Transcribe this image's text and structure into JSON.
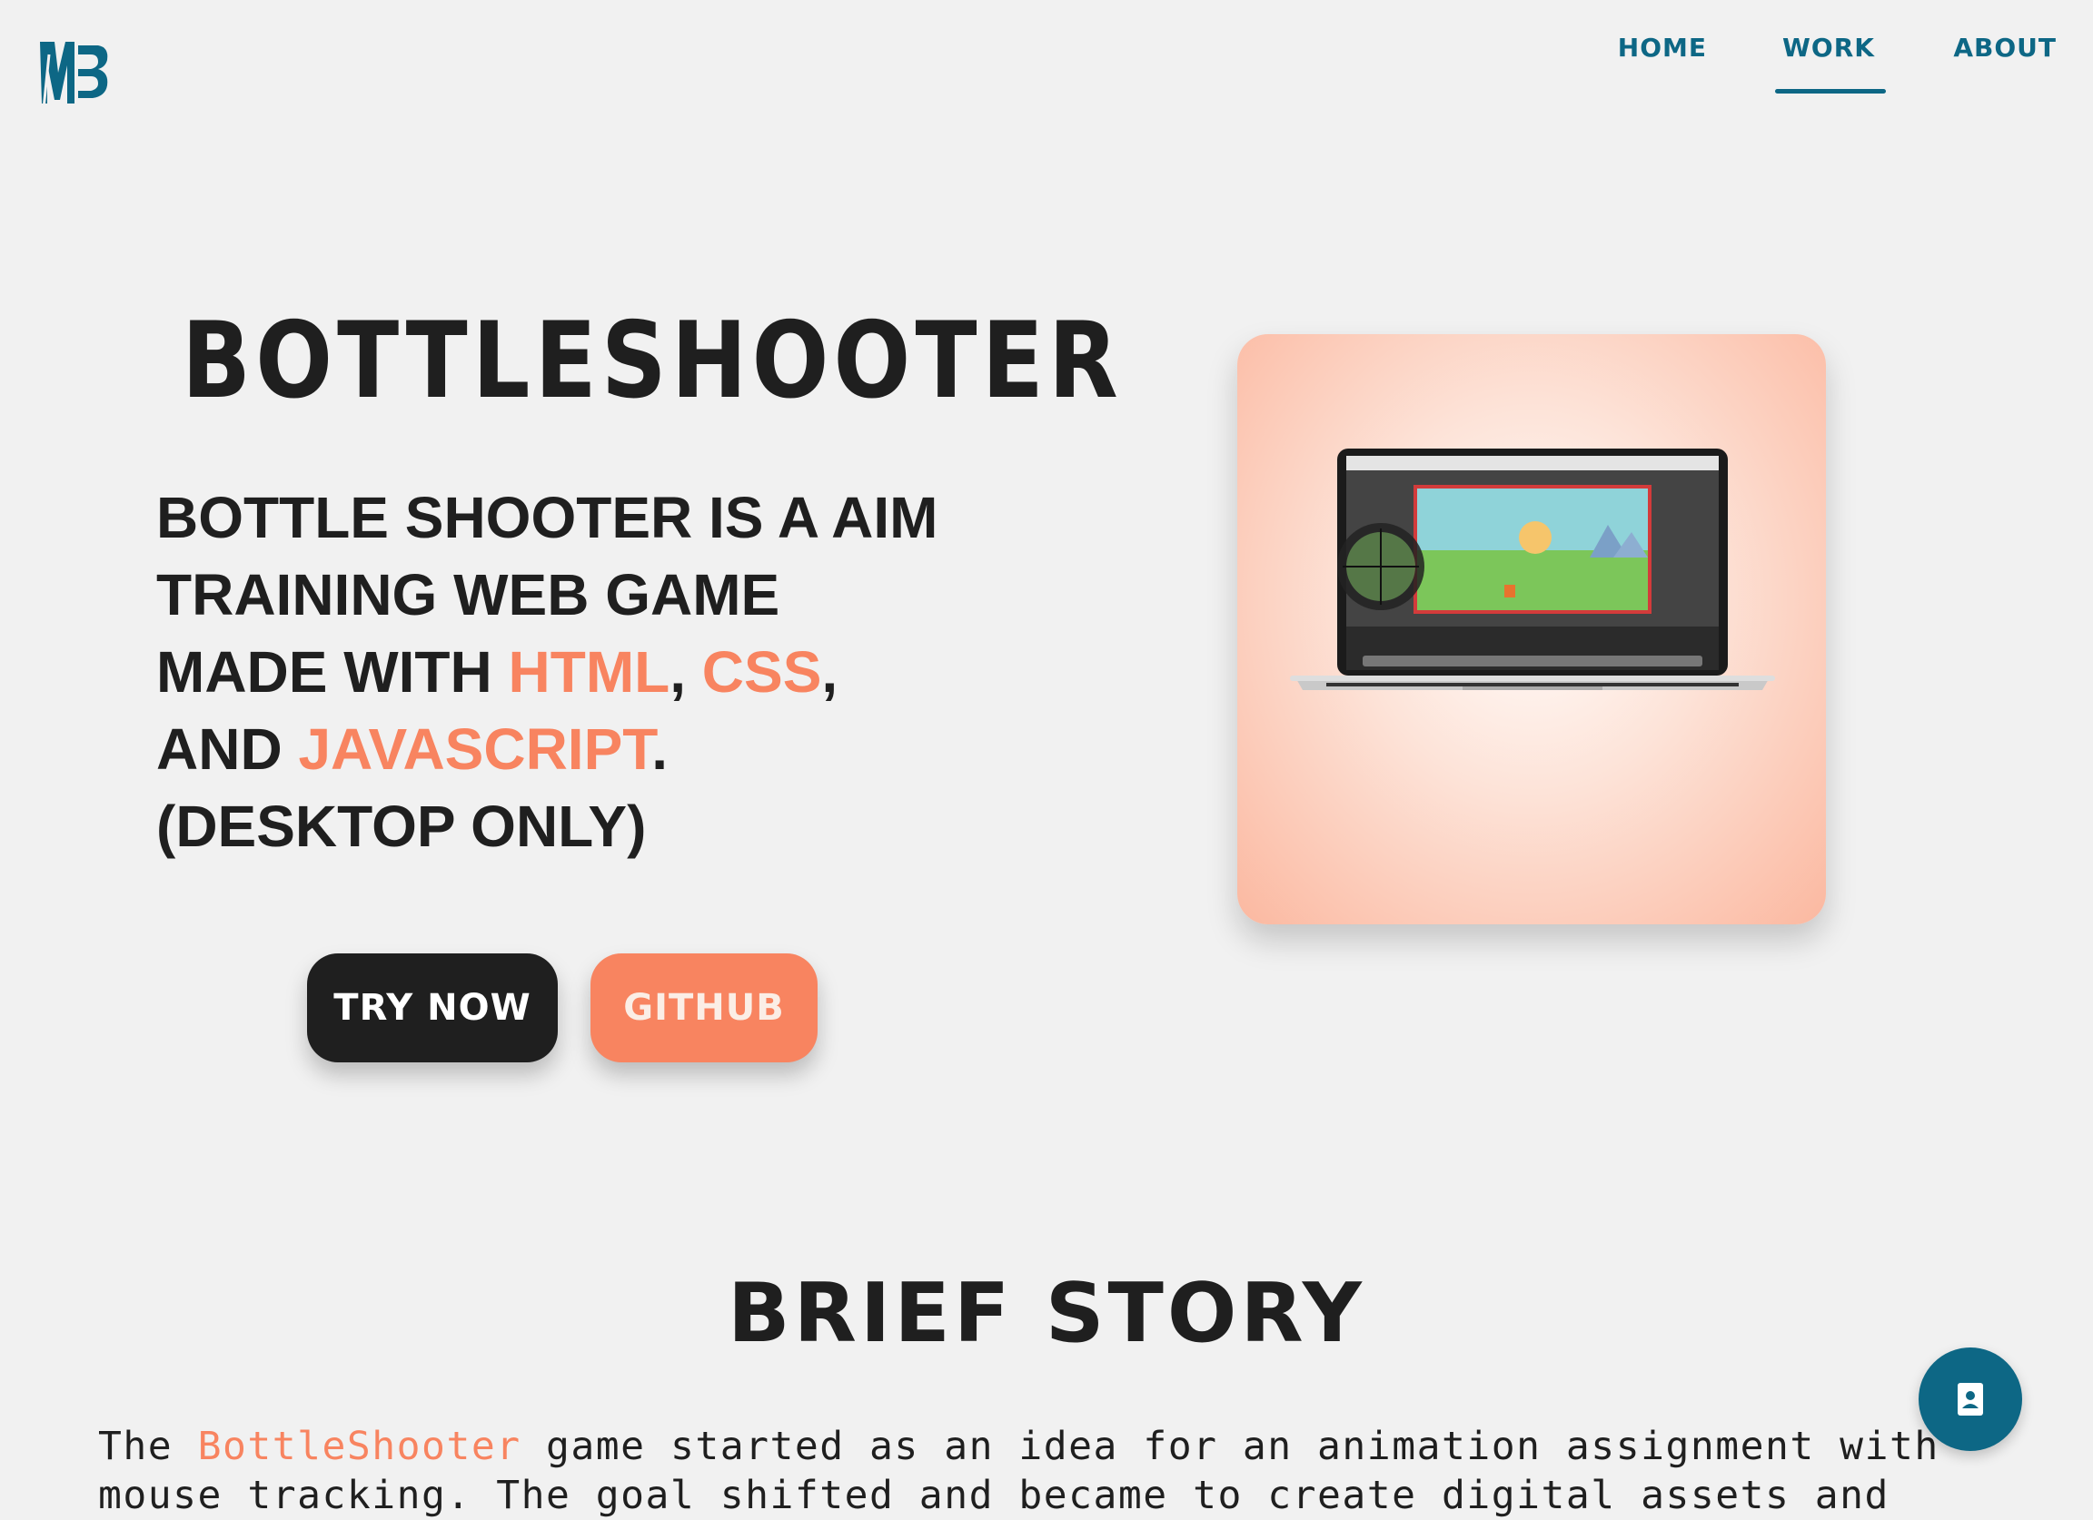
{
  "nav": {
    "home": "HOME",
    "work": "WORK",
    "about": "ABOUT",
    "active": "WORK"
  },
  "hero": {
    "title": "BOTTLESHOOTER",
    "description_prefix": "Bottle Shooter is a aim training web game made with ",
    "tech_1": "HTML",
    "sep_1": ", ",
    "tech_2": "CSS",
    "sep_2": ", and ",
    "tech_3": "JAVASCRIPT",
    "description_suffix": ". (DESKTOP ONLY)",
    "try_label": "TRY NOW",
    "github_label": "GITHUB"
  },
  "story": {
    "title": "BRIEF STORY",
    "text_prefix": "The ",
    "highlight": "BottleShooter",
    "text_suffix": " game started as an idea for an animation assignment with mouse tracking. The goal shifted and became to create digital assets and make a fully"
  },
  "colors": {
    "accent": "#f88460",
    "brand": "#0d6785",
    "dark": "#1f1f1f",
    "background": "#f1f1f1"
  },
  "icons": {
    "logo": "mb-logo-icon",
    "contact": "contact-card-icon"
  }
}
